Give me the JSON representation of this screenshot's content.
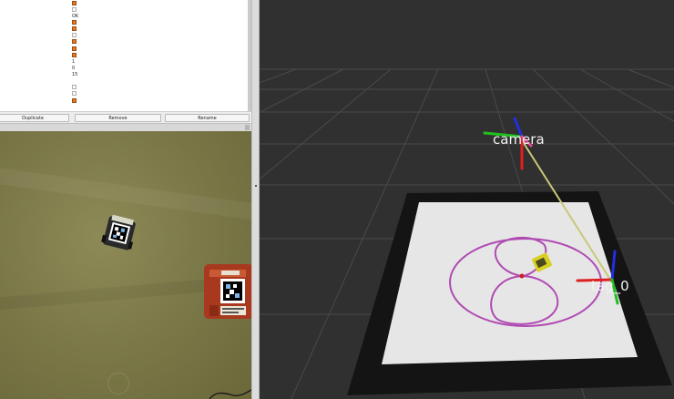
{
  "properties": {
    "values": [
      "OK",
      "1",
      "0",
      "15"
    ],
    "buttons": {
      "duplicate": "Duplicate",
      "remove": "Remove",
      "rename": "Rename"
    }
  },
  "viewport": {
    "frames": {
      "camera": "camera",
      "tag": "tag_0"
    },
    "colors": {
      "background": "#303030",
      "grid": "#4a4a4a",
      "board": "#141414",
      "paper": "#e6e6e6",
      "path": "#b04ab2",
      "link": "#c8c87a",
      "axis_x": "#e02020",
      "axis_y": "#20c020",
      "axis_z": "#2030e0"
    }
  }
}
